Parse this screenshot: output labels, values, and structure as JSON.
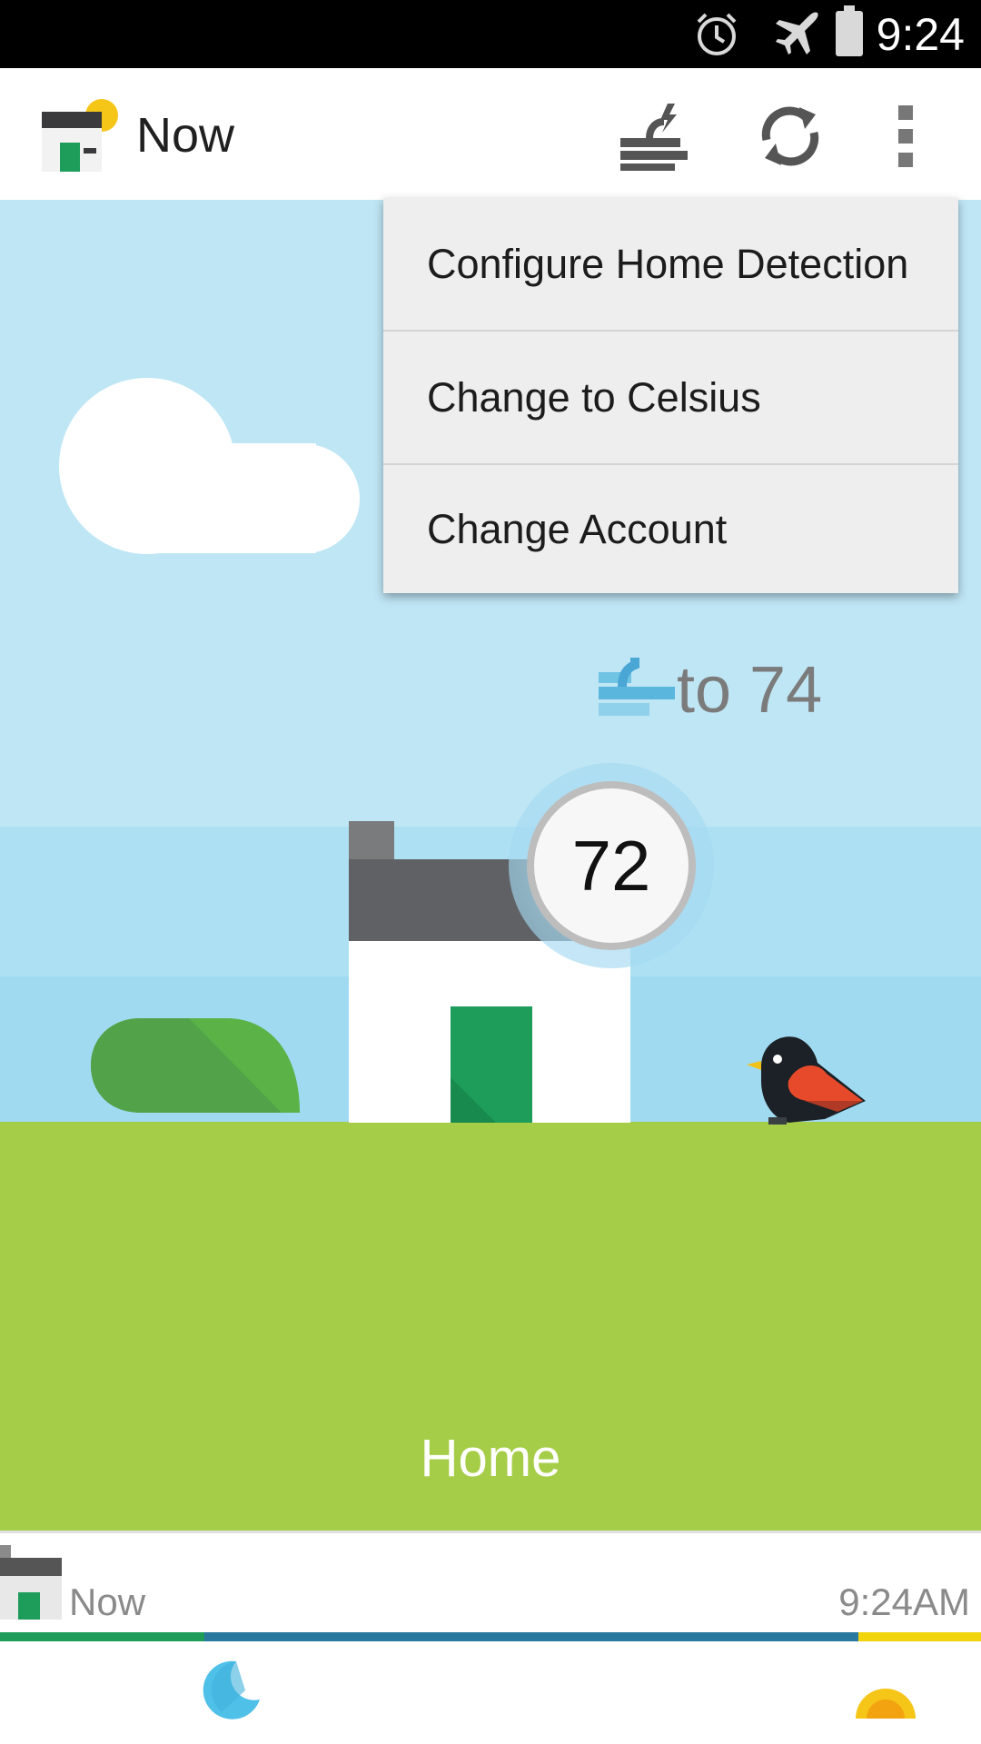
{
  "status_bar": {
    "time": "9:24",
    "icons": [
      "alarm-icon",
      "airplane-mode-icon",
      "battery-icon"
    ]
  },
  "app_bar": {
    "title": "Now",
    "actions": [
      "wind-icon",
      "sync-icon",
      "overflow-menu-icon"
    ]
  },
  "menu": {
    "items": [
      {
        "label": "Configure Home Detection"
      },
      {
        "label": "Change to Celsius"
      },
      {
        "label": "Change Account"
      }
    ]
  },
  "scene": {
    "target_text": "to 74",
    "current_temp": "72",
    "location_label": "Home"
  },
  "timeline": {
    "label": "Now",
    "time": "9:24AM"
  },
  "colors": {
    "sky": "#bfe6f5",
    "ground": "#a6cd48",
    "door": "#1e9c5a",
    "menu_bg": "#eeeeee",
    "timeline_green": "#1e9c5a",
    "timeline_blue": "#2878a0",
    "timeline_yellow": "#f2d40c"
  }
}
